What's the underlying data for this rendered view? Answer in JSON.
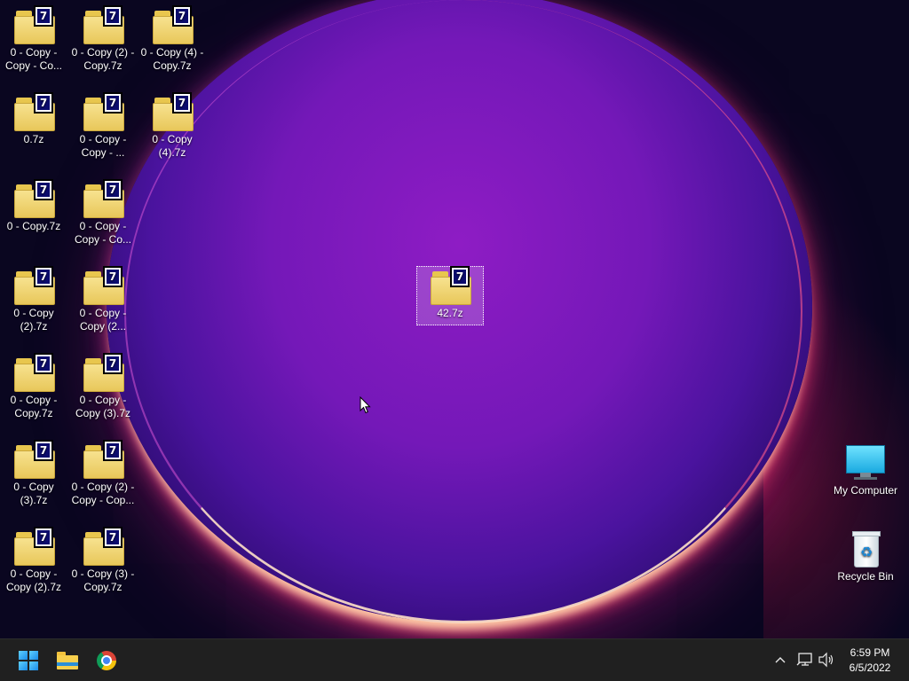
{
  "desktop": {
    "icons_left": [
      {
        "label": "0 - Copy - Copy - Co...",
        "type": "archive-7z"
      },
      {
        "label": "0 - Copy (2) - Copy.7z",
        "type": "archive-7z"
      },
      {
        "label": "0 - Copy (4) - Copy.7z",
        "type": "archive-7z"
      },
      {
        "label": "0.7z",
        "type": "archive-7z"
      },
      {
        "label": "0 - Copy - Copy - ...",
        "type": "archive-7z"
      },
      {
        "label": "0 - Copy (4).7z",
        "type": "archive-7z"
      },
      {
        "label": "0 - Copy.7z",
        "type": "archive-7z"
      },
      {
        "label": "0 - Copy - Copy - Co...",
        "type": "archive-7z"
      },
      {
        "label": "0 - Copy (2).7z",
        "type": "archive-7z"
      },
      {
        "label": "0 - Copy - Copy (2...",
        "type": "archive-7z"
      },
      {
        "label": "0 - Copy - Copy.7z",
        "type": "archive-7z"
      },
      {
        "label": "0 - Copy - Copy (3).7z",
        "type": "archive-7z"
      },
      {
        "label": "0 - Copy (3).7z",
        "type": "archive-7z"
      },
      {
        "label": "0 - Copy (2) - Copy - Cop...",
        "type": "archive-7z"
      },
      {
        "label": "0 - Copy - Copy (2).7z",
        "type": "archive-7z"
      },
      {
        "label": "0 - Copy (3) - Copy.7z",
        "type": "archive-7z"
      }
    ],
    "selected_icon": {
      "label": "42.7z",
      "type": "archive-7z",
      "selected": true
    },
    "system_icons": [
      {
        "label": "My Computer",
        "icon": "monitor-icon"
      },
      {
        "label": "Recycle Bin",
        "icon": "recycle-bin-icon"
      }
    ],
    "archive_badge_glyph": "7"
  },
  "taskbar": {
    "pinned": [
      {
        "name": "start",
        "icon": "windows-logo-icon"
      },
      {
        "name": "file-explorer",
        "icon": "folder-icon"
      },
      {
        "name": "chrome",
        "icon": "chrome-icon"
      }
    ],
    "tray": {
      "chevron_glyph": "^",
      "network_icon": "network-icon",
      "volume_icon": "volume-icon"
    },
    "clock": {
      "time": "6:59 PM",
      "date": "6/5/2022"
    }
  },
  "colors": {
    "taskbar_bg": "#202020",
    "desktop_bg": "#0a0620",
    "archive_folder": "#f7e28f",
    "archive_badge": "#0c0c6e"
  }
}
